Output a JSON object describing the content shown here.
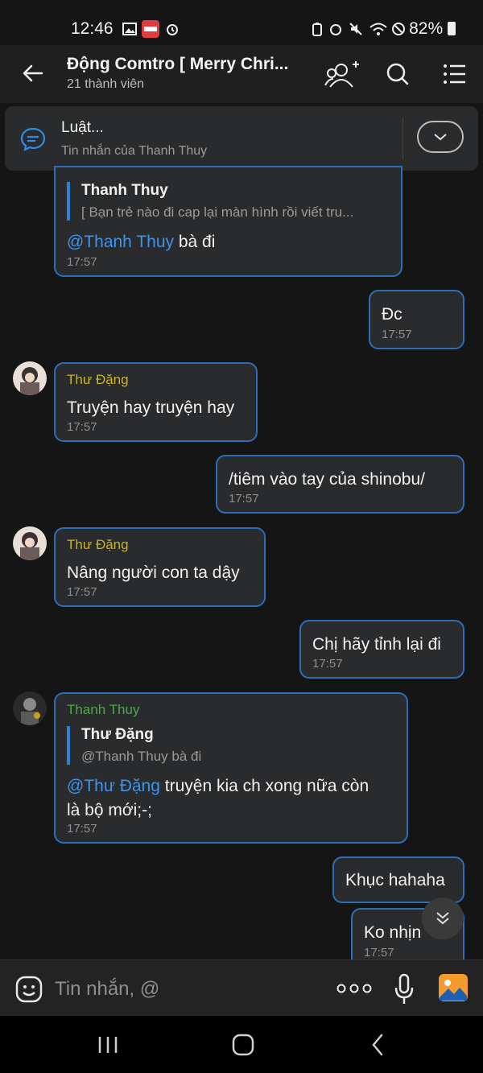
{
  "status_bar": {
    "time": "12:46",
    "battery": "82%"
  },
  "header": {
    "title": "Động Comtro [ Merry Chri...",
    "subtitle": "21 thành viên"
  },
  "pinned": {
    "title": "Luật...",
    "subtitle": "Tin nhắn của Thanh Thuy"
  },
  "messages": [
    {
      "quote_name": "Thanh Thuy",
      "quote_text": "[ Bạn trẻ nào đi cap lại màn hình rồi viết tru...",
      "mention": "@Thanh Thuy",
      "text": " bà đi",
      "time": "17:57"
    },
    {
      "text": "Đc",
      "time": "17:57"
    },
    {
      "sender": "Thư Đặng",
      "text": "Truyện hay truyện hay",
      "time": "17:57"
    },
    {
      "text": "/tiêm vào tay của shinobu/",
      "time": "17:57"
    },
    {
      "sender": "Thư Đặng",
      "text": "Nâng người con ta dậy",
      "time": "17:57"
    },
    {
      "text": "Chị hãy tỉnh lại đi",
      "time": "17:57"
    },
    {
      "sender": "Thanh Thuy",
      "quote_name": "Thư Đặng",
      "quote_text": "@Thanh Thuy bà đi",
      "mention": "@Thư Đặng",
      "text_line1": " truyện kia ch xong nữa còn",
      "text_line2": "là bộ mới;-;",
      "time": "17:57"
    },
    {
      "text": "Khục hahaha"
    },
    {
      "text": "Ko nhịn",
      "time": "17:57"
    }
  ],
  "input": {
    "placeholder": "Tin nhắn, @"
  },
  "colors": {
    "accent_border": "#2d6fb6",
    "mention": "#3c94ee",
    "sender_yellow": "#c8b324",
    "sender_green": "#4fa64f"
  }
}
